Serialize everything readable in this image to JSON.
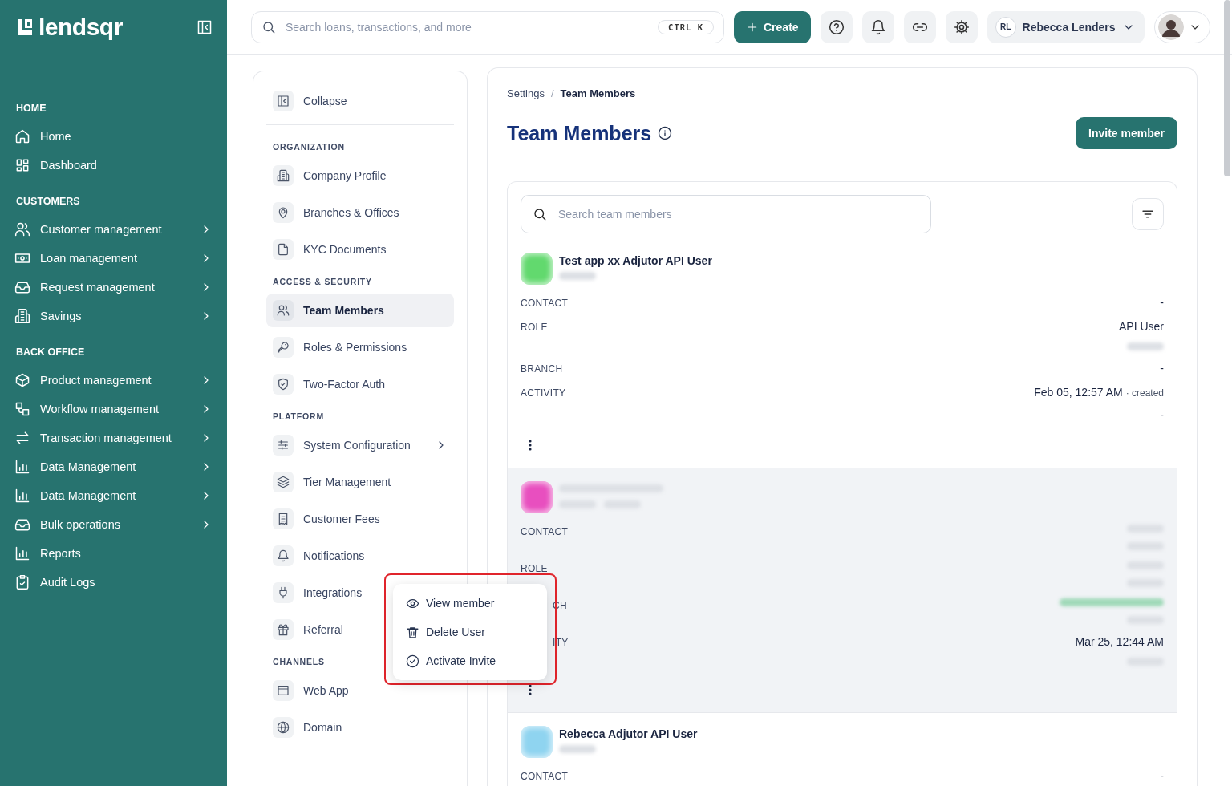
{
  "brand": {
    "name": "lendsqr"
  },
  "topbar": {
    "search": {
      "placeholder": "Search loans, transactions, and more",
      "shortcut": "CTRL K"
    },
    "create_button": "Create",
    "user": {
      "initials": "RL",
      "name": "Rebecca Lenders"
    }
  },
  "sidebar": {
    "sections": [
      {
        "title": "HOME",
        "items": [
          {
            "label": "Home",
            "expandable": false
          },
          {
            "label": "Dashboard",
            "expandable": false
          }
        ]
      },
      {
        "title": "CUSTOMERS",
        "items": [
          {
            "label": "Customer management",
            "expandable": true
          },
          {
            "label": "Loan management",
            "expandable": true
          },
          {
            "label": "Request management",
            "expandable": true
          },
          {
            "label": "Savings",
            "expandable": true
          }
        ]
      },
      {
        "title": "BACK OFFICE",
        "items": [
          {
            "label": "Product management",
            "expandable": true
          },
          {
            "label": "Workflow management",
            "expandable": true
          },
          {
            "label": "Transaction management",
            "expandable": true
          },
          {
            "label": "Data Management",
            "expandable": true
          },
          {
            "label": "Data Management",
            "expandable": true
          },
          {
            "label": "Bulk operations",
            "expandable": true
          },
          {
            "label": "Reports",
            "expandable": false
          },
          {
            "label": "Audit Logs",
            "expandable": false
          }
        ]
      }
    ]
  },
  "settings_nav": {
    "collapse": "Collapse",
    "sections": [
      {
        "title": "ORGANIZATION",
        "items": [
          {
            "label": "Company Profile",
            "selected": false
          },
          {
            "label": "Branches & Offices",
            "selected": false
          },
          {
            "label": "KYC Documents",
            "selected": false
          }
        ]
      },
      {
        "title": "ACCESS & SECURITY",
        "items": [
          {
            "label": "Team Members",
            "selected": true
          },
          {
            "label": "Roles & Permissions",
            "selected": false
          },
          {
            "label": "Two-Factor Auth",
            "selected": false
          }
        ]
      },
      {
        "title": "PLATFORM",
        "items": [
          {
            "label": "System Configuration",
            "selected": false,
            "expandable": true
          },
          {
            "label": "Tier Management",
            "selected": false
          },
          {
            "label": "Customer Fees",
            "selected": false
          },
          {
            "label": "Notifications",
            "selected": false
          },
          {
            "label": "Integrations",
            "selected": false
          },
          {
            "label": "Referral",
            "selected": false
          }
        ]
      },
      {
        "title": "CHANNELS",
        "items": [
          {
            "label": "Web App",
            "selected": false
          },
          {
            "label": "Domain",
            "selected": false
          }
        ]
      }
    ]
  },
  "breadcrumb": {
    "separator": "/",
    "items": [
      {
        "label": "Settings",
        "current": false
      },
      {
        "label": "Team Members",
        "current": true
      }
    ]
  },
  "page": {
    "title": "Team Members",
    "action": "Invite member"
  },
  "member_search": {
    "placeholder": "Search team members"
  },
  "members": [
    {
      "name": "Test app xx Adjutor API User",
      "color": "#62d96e",
      "highlighted": false,
      "subtitle": [
        {
          "kind": "redacted"
        }
      ],
      "fields": [
        {
          "label": "CONTACT",
          "cut": false,
          "values": [
            {
              "kind": "text",
              "text": "-"
            }
          ]
        },
        {
          "label": "ROLE",
          "cut": false,
          "values": [
            {
              "kind": "text",
              "text": "API User"
            },
            {
              "kind": "redacted"
            }
          ]
        },
        {
          "label": "BRANCH",
          "cut": false,
          "values": [
            {
              "kind": "text",
              "text": "-"
            }
          ]
        },
        {
          "label": "ACTIVITY",
          "cut": false,
          "values": [
            {
              "kind": "text",
              "text": "Feb 05, 12:57 AM",
              "note": "· created"
            },
            {
              "kind": "text",
              "text": "-"
            }
          ]
        }
      ]
    },
    {
      "color": "#e84fbf",
      "highlighted": true,
      "subtitle": [
        {
          "kind": "redacted"
        },
        {
          "kind": "redacted"
        }
      ],
      "fields": [
        {
          "label": "CONTACT",
          "cut": false,
          "values": [
            {
              "kind": "redacted"
            },
            {
              "kind": "redacted"
            }
          ]
        },
        {
          "label": "ROLE",
          "cut": false,
          "values": [
            {
              "kind": "redacted"
            },
            {
              "kind": "redacted"
            }
          ]
        },
        {
          "label": "CH",
          "cut": true,
          "values": [
            {
              "kind": "redacted",
              "color": "#9fd9b8"
            },
            {
              "kind": "redacted"
            }
          ]
        },
        {
          "label": "ITY",
          "cut": true,
          "values": [
            {
              "kind": "text",
              "text": "Mar 25, 12:44 AM"
            },
            {
              "kind": "redacted"
            }
          ]
        }
      ]
    },
    {
      "name": "Rebecca Adjutor API User",
      "color": "#8fd4f0",
      "highlighted": false,
      "subtitle": [
        {
          "kind": "redacted"
        }
      ],
      "fields": [
        {
          "label": "CONTACT",
          "cut": false,
          "values": [
            {
              "kind": "text",
              "text": "-"
            }
          ]
        }
      ]
    }
  ],
  "context_menu": {
    "items": [
      {
        "label": "View member"
      },
      {
        "label": "Delete User"
      },
      {
        "label": "Activate Invite"
      }
    ]
  }
}
